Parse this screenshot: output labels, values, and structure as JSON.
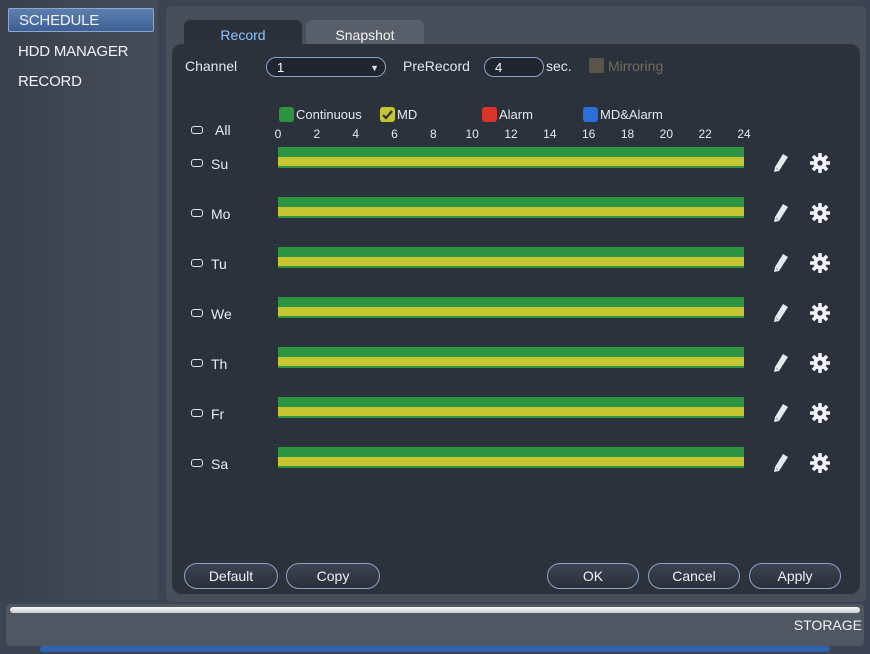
{
  "sidebar": {
    "items": [
      {
        "label": "SCHEDULE",
        "active": true
      },
      {
        "label": "HDD MANAGER",
        "active": false
      },
      {
        "label": "RECORD",
        "active": false
      }
    ]
  },
  "tabs": [
    {
      "label": "Record",
      "active": true
    },
    {
      "label": "Snapshot",
      "active": false
    }
  ],
  "settings": {
    "channel_label": "Channel",
    "channel_value": "1",
    "prerecord_label": "PreRecord",
    "prerecord_value": "4",
    "prerecord_unit": "sec.",
    "mirroring_label": "Mirroring",
    "mirroring_enabled": false
  },
  "legend": [
    {
      "label": "Continuous",
      "color": "#2f9442",
      "checked": false
    },
    {
      "label": "MD",
      "color": "#c6c633",
      "checked": true
    },
    {
      "label": "Alarm",
      "color": "#d9342b",
      "checked": false
    },
    {
      "label": "MD&Alarm",
      "color": "#2c6fd8",
      "checked": false
    }
  ],
  "all_label": "All",
  "hour_ticks": [
    "0",
    "2",
    "4",
    "6",
    "8",
    "10",
    "12",
    "14",
    "16",
    "18",
    "20",
    "22",
    "24"
  ],
  "days": [
    {
      "label": "Su",
      "continuous": [
        0,
        24
      ],
      "md": [
        0,
        24
      ]
    },
    {
      "label": "Mo",
      "continuous": [
        0,
        24
      ],
      "md": [
        0,
        24
      ]
    },
    {
      "label": "Tu",
      "continuous": [
        0,
        24
      ],
      "md": [
        0,
        24
      ]
    },
    {
      "label": "We",
      "continuous": [
        0,
        24
      ],
      "md": [
        0,
        24
      ]
    },
    {
      "label": "Th",
      "continuous": [
        0,
        24
      ],
      "md": [
        0,
        24
      ]
    },
    {
      "label": "Fr",
      "continuous": [
        0,
        24
      ],
      "md": [
        0,
        24
      ]
    },
    {
      "label": "Sa",
      "continuous": [
        0,
        24
      ],
      "md": [
        0,
        24
      ]
    }
  ],
  "buttons": {
    "default": "Default",
    "copy": "Copy",
    "ok": "OK",
    "cancel": "Cancel",
    "apply": "Apply"
  },
  "footer": {
    "label": "STORAGE"
  },
  "icons": {
    "edit": "pencil-icon",
    "settings": "gear-icon"
  }
}
